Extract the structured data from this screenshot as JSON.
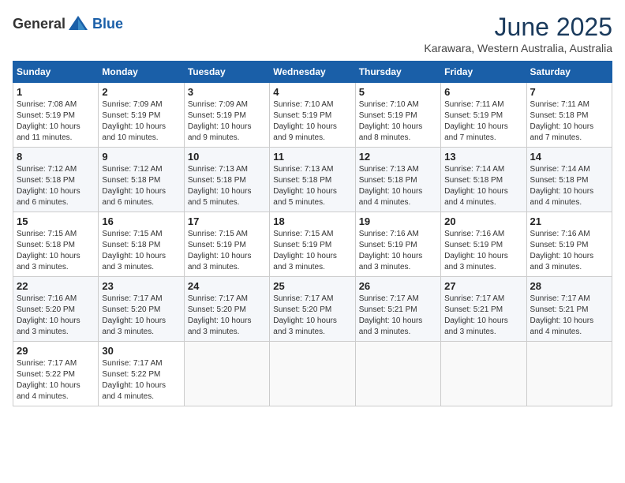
{
  "header": {
    "logo_general": "General",
    "logo_blue": "Blue",
    "month_year": "June 2025",
    "location": "Karawara, Western Australia, Australia"
  },
  "calendar": {
    "headers": [
      "Sunday",
      "Monday",
      "Tuesday",
      "Wednesday",
      "Thursday",
      "Friday",
      "Saturday"
    ],
    "weeks": [
      [
        {
          "day": "1",
          "sunrise": "Sunrise: 7:08 AM",
          "sunset": "Sunset: 5:19 PM",
          "daylight": "Daylight: 10 hours and 11 minutes."
        },
        {
          "day": "2",
          "sunrise": "Sunrise: 7:09 AM",
          "sunset": "Sunset: 5:19 PM",
          "daylight": "Daylight: 10 hours and 10 minutes."
        },
        {
          "day": "3",
          "sunrise": "Sunrise: 7:09 AM",
          "sunset": "Sunset: 5:19 PM",
          "daylight": "Daylight: 10 hours and 9 minutes."
        },
        {
          "day": "4",
          "sunrise": "Sunrise: 7:10 AM",
          "sunset": "Sunset: 5:19 PM",
          "daylight": "Daylight: 10 hours and 9 minutes."
        },
        {
          "day": "5",
          "sunrise": "Sunrise: 7:10 AM",
          "sunset": "Sunset: 5:19 PM",
          "daylight": "Daylight: 10 hours and 8 minutes."
        },
        {
          "day": "6",
          "sunrise": "Sunrise: 7:11 AM",
          "sunset": "Sunset: 5:19 PM",
          "daylight": "Daylight: 10 hours and 7 minutes."
        },
        {
          "day": "7",
          "sunrise": "Sunrise: 7:11 AM",
          "sunset": "Sunset: 5:18 PM",
          "daylight": "Daylight: 10 hours and 7 minutes."
        }
      ],
      [
        {
          "day": "8",
          "sunrise": "Sunrise: 7:12 AM",
          "sunset": "Sunset: 5:18 PM",
          "daylight": "Daylight: 10 hours and 6 minutes."
        },
        {
          "day": "9",
          "sunrise": "Sunrise: 7:12 AM",
          "sunset": "Sunset: 5:18 PM",
          "daylight": "Daylight: 10 hours and 6 minutes."
        },
        {
          "day": "10",
          "sunrise": "Sunrise: 7:13 AM",
          "sunset": "Sunset: 5:18 PM",
          "daylight": "Daylight: 10 hours and 5 minutes."
        },
        {
          "day": "11",
          "sunrise": "Sunrise: 7:13 AM",
          "sunset": "Sunset: 5:18 PM",
          "daylight": "Daylight: 10 hours and 5 minutes."
        },
        {
          "day": "12",
          "sunrise": "Sunrise: 7:13 AM",
          "sunset": "Sunset: 5:18 PM",
          "daylight": "Daylight: 10 hours and 4 minutes."
        },
        {
          "day": "13",
          "sunrise": "Sunrise: 7:14 AM",
          "sunset": "Sunset: 5:18 PM",
          "daylight": "Daylight: 10 hours and 4 minutes."
        },
        {
          "day": "14",
          "sunrise": "Sunrise: 7:14 AM",
          "sunset": "Sunset: 5:18 PM",
          "daylight": "Daylight: 10 hours and 4 minutes."
        }
      ],
      [
        {
          "day": "15",
          "sunrise": "Sunrise: 7:15 AM",
          "sunset": "Sunset: 5:18 PM",
          "daylight": "Daylight: 10 hours and 3 minutes."
        },
        {
          "day": "16",
          "sunrise": "Sunrise: 7:15 AM",
          "sunset": "Sunset: 5:18 PM",
          "daylight": "Daylight: 10 hours and 3 minutes."
        },
        {
          "day": "17",
          "sunrise": "Sunrise: 7:15 AM",
          "sunset": "Sunset: 5:19 PM",
          "daylight": "Daylight: 10 hours and 3 minutes."
        },
        {
          "day": "18",
          "sunrise": "Sunrise: 7:15 AM",
          "sunset": "Sunset: 5:19 PM",
          "daylight": "Daylight: 10 hours and 3 minutes."
        },
        {
          "day": "19",
          "sunrise": "Sunrise: 7:16 AM",
          "sunset": "Sunset: 5:19 PM",
          "daylight": "Daylight: 10 hours and 3 minutes."
        },
        {
          "day": "20",
          "sunrise": "Sunrise: 7:16 AM",
          "sunset": "Sunset: 5:19 PM",
          "daylight": "Daylight: 10 hours and 3 minutes."
        },
        {
          "day": "21",
          "sunrise": "Sunrise: 7:16 AM",
          "sunset": "Sunset: 5:19 PM",
          "daylight": "Daylight: 10 hours and 3 minutes."
        }
      ],
      [
        {
          "day": "22",
          "sunrise": "Sunrise: 7:16 AM",
          "sunset": "Sunset: 5:20 PM",
          "daylight": "Daylight: 10 hours and 3 minutes."
        },
        {
          "day": "23",
          "sunrise": "Sunrise: 7:17 AM",
          "sunset": "Sunset: 5:20 PM",
          "daylight": "Daylight: 10 hours and 3 minutes."
        },
        {
          "day": "24",
          "sunrise": "Sunrise: 7:17 AM",
          "sunset": "Sunset: 5:20 PM",
          "daylight": "Daylight: 10 hours and 3 minutes."
        },
        {
          "day": "25",
          "sunrise": "Sunrise: 7:17 AM",
          "sunset": "Sunset: 5:20 PM",
          "daylight": "Daylight: 10 hours and 3 minutes."
        },
        {
          "day": "26",
          "sunrise": "Sunrise: 7:17 AM",
          "sunset": "Sunset: 5:21 PM",
          "daylight": "Daylight: 10 hours and 3 minutes."
        },
        {
          "day": "27",
          "sunrise": "Sunrise: 7:17 AM",
          "sunset": "Sunset: 5:21 PM",
          "daylight": "Daylight: 10 hours and 3 minutes."
        },
        {
          "day": "28",
          "sunrise": "Sunrise: 7:17 AM",
          "sunset": "Sunset: 5:21 PM",
          "daylight": "Daylight: 10 hours and 4 minutes."
        }
      ],
      [
        {
          "day": "29",
          "sunrise": "Sunrise: 7:17 AM",
          "sunset": "Sunset: 5:22 PM",
          "daylight": "Daylight: 10 hours and 4 minutes."
        },
        {
          "day": "30",
          "sunrise": "Sunrise: 7:17 AM",
          "sunset": "Sunset: 5:22 PM",
          "daylight": "Daylight: 10 hours and 4 minutes."
        },
        null,
        null,
        null,
        null,
        null
      ]
    ]
  }
}
